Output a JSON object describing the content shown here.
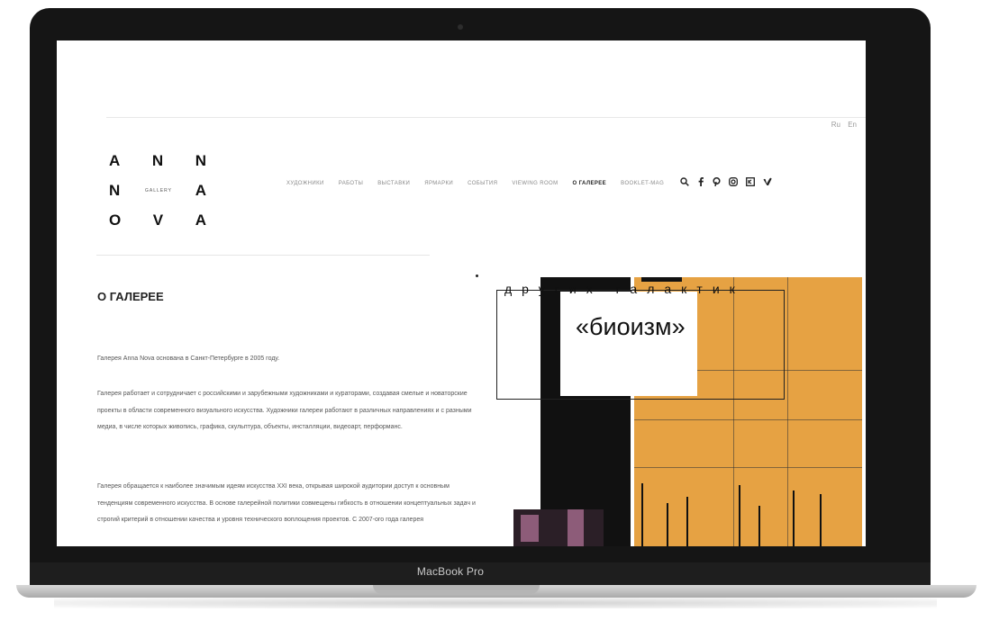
{
  "device": {
    "label": "MacBook Pro"
  },
  "lang": [
    "Ru",
    "En"
  ],
  "logo": {
    "row1": [
      "A",
      "N",
      "N"
    ],
    "row2": [
      "N",
      "GALLERY",
      "A"
    ],
    "row3": [
      "O",
      "V",
      "A"
    ]
  },
  "nav": [
    {
      "label": "ХУДОЖНИКИ"
    },
    {
      "label": "РАБОТЫ"
    },
    {
      "label": "ВЫСТАВКИ"
    },
    {
      "label": "ЯРМАРКИ"
    },
    {
      "label": "СОБЫТИЯ"
    },
    {
      "label": "VIEWING ROOM"
    },
    {
      "label": "О ГАЛЕРЕЕ"
    },
    {
      "label": "BOOKLET-MAG"
    }
  ],
  "icons": [
    "search-icon",
    "facebook-icon",
    "pinterest-icon",
    "instagram-icon",
    "vk-icon",
    "vimeo-icon"
  ],
  "page": {
    "title": "О ГАЛЕРЕЕ",
    "p1": "Галерея Anna Nova основана в Санкт-Петербурге в 2005 году.",
    "p2": "Галерея работает и сотрудничает с российскими и зарубежными художниками и кураторами, создавая смелые и новаторские проекты в области современного визуального искусства. Художники галереи работают в различных направлениях и с разными медиа, в числе которых живопись, графика, скульптура, объекты, инсталляции, видеоарт, перформанс.",
    "p3": "Галерея обращается к наиболее значимым идеям искусства XXI века, открывая широкой аудитории доступ к основным тенденциям современного искусства. В основе галерейной политики совмещены гибкость в отношении концептуальных задач и строгий критерий в отношении качества и уровня технического воплощения проектов. С 2007-ого года галерея"
  },
  "artwork": {
    "line1": "других галактик",
    "line2": "«биоизм»",
    "accent": "#e6a243"
  }
}
